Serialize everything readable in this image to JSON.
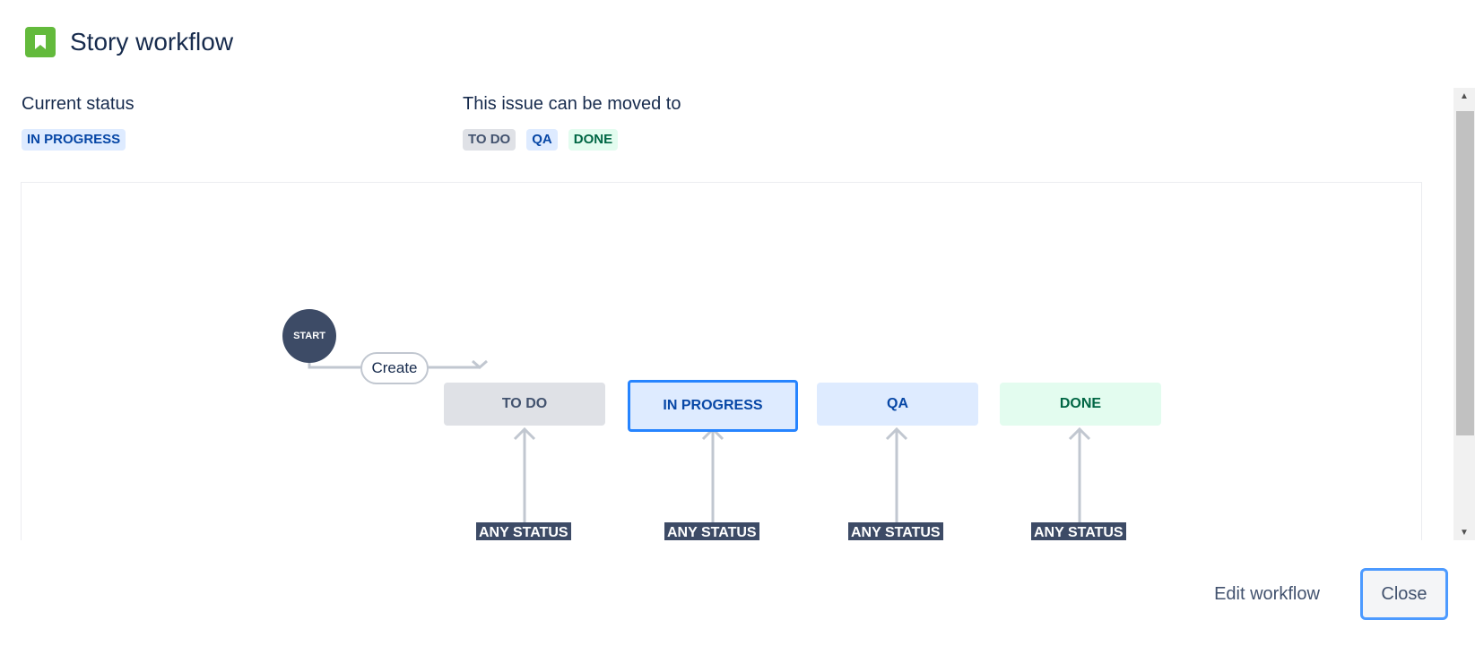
{
  "dialog": {
    "title": "Story workflow",
    "icon": "bookmark-icon",
    "icon_color": "#63ba3c"
  },
  "current_status": {
    "label": "Current status",
    "value": "IN PROGRESS"
  },
  "moved_to": {
    "label": "This issue can be moved to",
    "statuses": [
      "TO DO",
      "QA",
      "DONE"
    ]
  },
  "diagram": {
    "start": "START",
    "create_transition": "Create",
    "statuses": [
      "TO DO",
      "IN PROGRESS",
      "QA",
      "DONE"
    ],
    "any_status": [
      "ANY STATUS",
      "ANY STATUS",
      "ANY STATUS",
      "ANY STATUS"
    ]
  },
  "footer": {
    "edit_label": "Edit workflow",
    "close_label": "Close"
  },
  "colors": {
    "accent_blue": "#2684ff",
    "node_dark": "#3d4b66",
    "todo_bg": "#dfe1e6",
    "qa_bg": "#deebff",
    "done_bg": "#e3fcef"
  }
}
